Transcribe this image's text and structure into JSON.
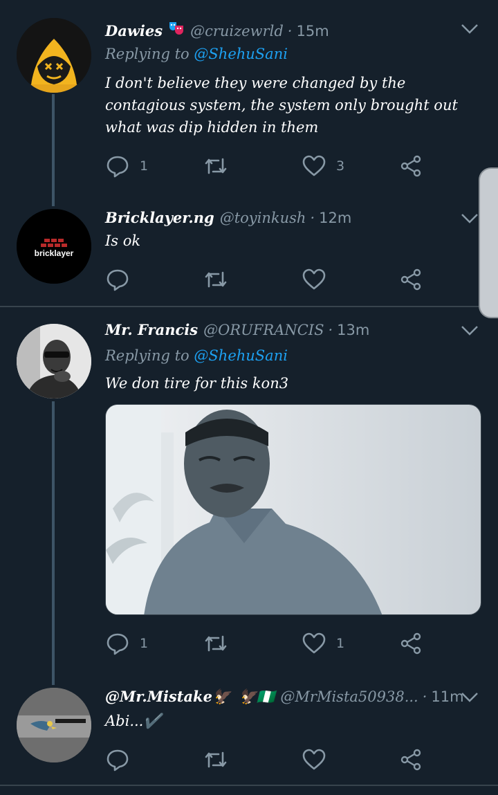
{
  "tweets": [
    {
      "name": "Dawies",
      "handle": "@cruizewrld",
      "time": "15m",
      "reply_to_prefix": "Replying to",
      "reply_to_handle": "@ShehuSani",
      "text": "I don't believe they were changed by the contagious system, the system only brought out what was dip hidden in them",
      "reply_count": "1",
      "retweet_count": "",
      "like_count": "3"
    },
    {
      "name": "Bricklayer.ng",
      "handle": "@toyinkush",
      "time": "12m",
      "avatar_text": "bricklayer",
      "text": "Is ok",
      "reply_count": "",
      "retweet_count": "",
      "like_count": ""
    },
    {
      "name": "Mr. Francis",
      "handle": "@ORUFRANCIS",
      "time": "13m",
      "reply_to_prefix": "Replying to",
      "reply_to_handle": "@ShehuSani",
      "text": "We don tire for this kon3",
      "reply_count": "1",
      "retweet_count": "",
      "like_count": "1"
    },
    {
      "name": "@Mr.Mistake🦅",
      "name_suffix": "🦅🇳🇬",
      "handle": "@MrMista50938...",
      "time": "11m",
      "text": "Abi...✔️",
      "reply_count": "",
      "retweet_count": "",
      "like_count": ""
    }
  ],
  "separator": "·",
  "colors": {
    "background": "#15202b",
    "secondary_text": "#8899a6",
    "link": "#1da1f2",
    "divider": "#38444d"
  }
}
